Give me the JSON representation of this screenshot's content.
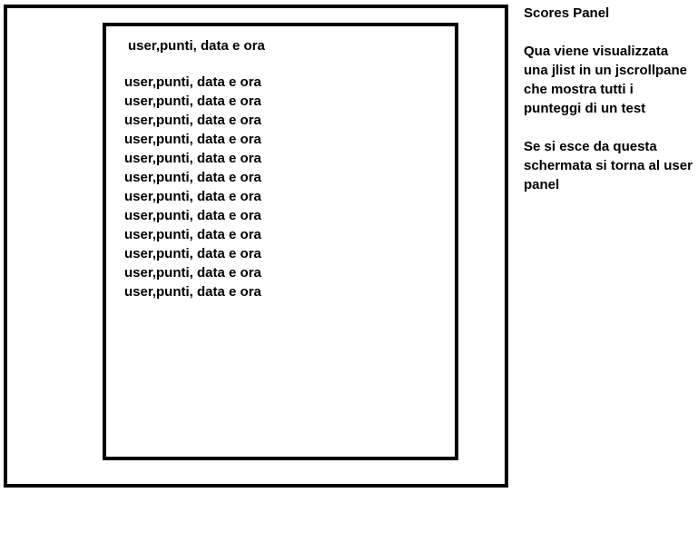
{
  "panel": {
    "header": "user,punti, data e ora",
    "rows": [
      "user,punti, data e ora",
      "user,punti, data e ora",
      "user,punti, data e ora",
      "user,punti, data e ora",
      "user,punti, data e ora",
      "user,punti, data e ora",
      "user,punti, data e ora",
      "user,punti, data e ora",
      "user,punti, data e ora",
      "user,punti, data e ora",
      "user,punti, data e ora",
      "user,punti, data e ora"
    ]
  },
  "notes": {
    "title": "Scores Panel",
    "description": "Qua viene visualizzata una jlist in un jscrollpane che mostra tutti i punteggi di un test",
    "exit_note": "Se si esce da questa schermata si torna al user panel"
  },
  "colors": {
    "border": "#000000",
    "background": "#ffffff",
    "text": "#000000"
  }
}
